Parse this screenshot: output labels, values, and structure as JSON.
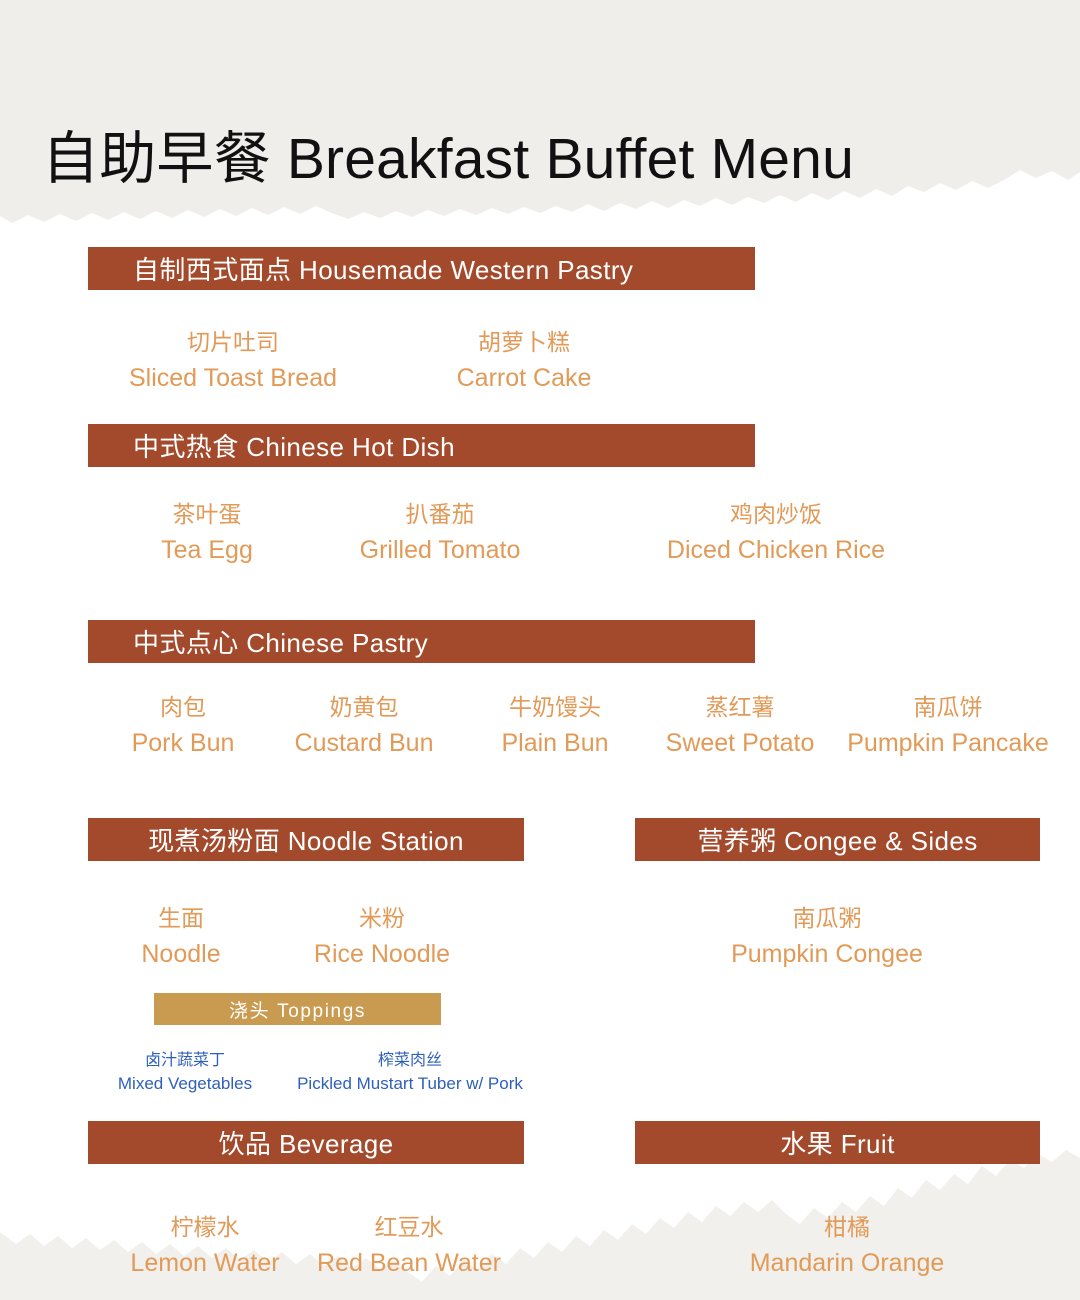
{
  "page": {
    "title_cn": "自助早餐",
    "title_en": "Breakfast Buffet Menu",
    "title_full": "自助早餐 Breakfast Buffet Menu"
  },
  "colors": {
    "bar_brown": "#a34a2c",
    "bar_gold": "#c99b50",
    "item_orange": "#e19a57",
    "topping_blue": "#2f60b9",
    "paper_beige": "#f0eeea",
    "background": "#ffffff",
    "title_black": "#111111"
  },
  "sections": [
    {
      "id": "western-pastry",
      "heading": "自制西式面点 Housemade Western Pastry",
      "heading_cn": "自制西式面点",
      "heading_en": "Housemade Western Pastry",
      "items": [
        {
          "cn": "切片吐司",
          "en": "Sliced Toast Bread"
        },
        {
          "cn": "胡萝卜糕",
          "en": "Carrot Cake"
        }
      ]
    },
    {
      "id": "chinese-hot-dish",
      "heading": "中式热食 Chinese Hot Dish",
      "heading_cn": "中式热食",
      "heading_en": "Chinese Hot Dish",
      "items": [
        {
          "cn": "茶叶蛋",
          "en": "Tea Egg"
        },
        {
          "cn": "扒番茄",
          "en": "Grilled Tomato"
        },
        {
          "cn": "鸡肉炒饭",
          "en": "Diced Chicken Rice"
        }
      ]
    },
    {
      "id": "chinese-pastry",
      "heading": "中式点心 Chinese Pastry",
      "heading_cn": "中式点心",
      "heading_en": "Chinese Pastry",
      "items": [
        {
          "cn": "肉包",
          "en": "Pork Bun"
        },
        {
          "cn": "奶黄包",
          "en": "Custard Bun"
        },
        {
          "cn": "牛奶馒头",
          "en": "Plain Bun"
        },
        {
          "cn": "蒸红薯",
          "en": "Sweet Potato"
        },
        {
          "cn": "南瓜饼",
          "en": "Pumpkin Pancake"
        }
      ]
    },
    {
      "id": "noodle-station",
      "heading": "现煮汤粉面  Noodle Station",
      "heading_cn": "现煮汤粉面",
      "heading_en": "Noodle Station",
      "items": [
        {
          "cn": "生面",
          "en": "Noodle"
        },
        {
          "cn": "米粉",
          "en": "Rice Noodle"
        }
      ]
    },
    {
      "id": "congee-sides",
      "heading": "营养粥 Congee & Sides",
      "heading_cn": "营养粥",
      "heading_en": "Congee & Sides",
      "items": [
        {
          "cn": "南瓜粥",
          "en": "Pumpkin Congee"
        }
      ]
    },
    {
      "id": "toppings",
      "heading": "浇头 Toppings",
      "heading_cn": "浇头",
      "heading_en": "Toppings",
      "items": [
        {
          "cn": "卤汁蔬菜丁",
          "en": "Mixed Vegetables"
        },
        {
          "cn": "榨菜肉丝",
          "en": "Pickled Mustart Tuber w/ Pork"
        }
      ]
    },
    {
      "id": "beverage",
      "heading": "饮品 Beverage",
      "heading_cn": "饮品",
      "heading_en": "Beverage",
      "items": [
        {
          "cn": "柠檬水",
          "en": "Lemon Water"
        },
        {
          "cn": "红豆水",
          "en": "Red Bean Water"
        }
      ]
    },
    {
      "id": "fruit",
      "heading": "水果 Fruit",
      "heading_cn": "水果",
      "heading_en": "Fruit",
      "items": [
        {
          "cn": "柑橘",
          "en": "Mandarin Orange"
        }
      ]
    }
  ]
}
